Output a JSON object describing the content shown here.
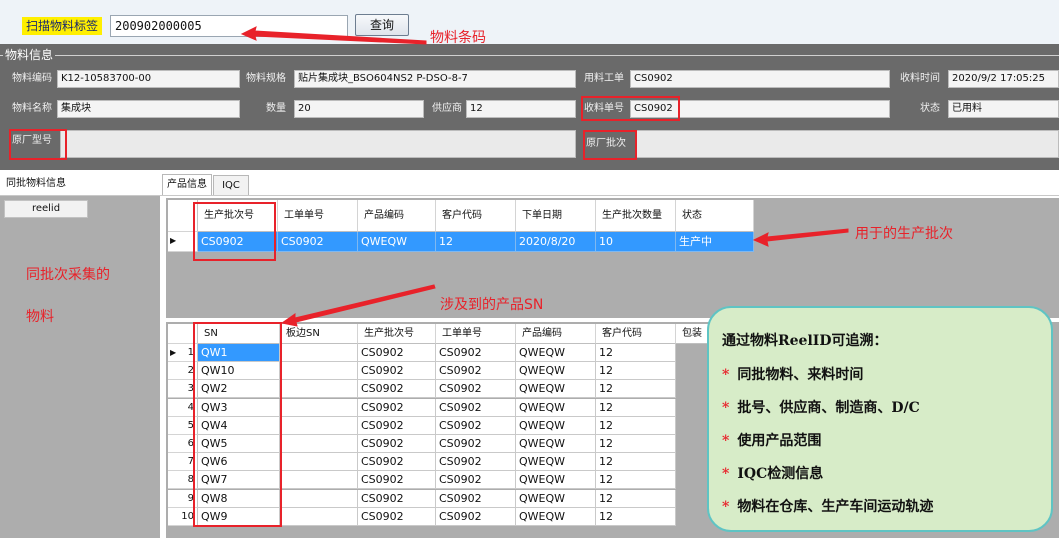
{
  "scan": {
    "label": "扫描物料标签",
    "value": "200902000005",
    "query_button": "查询",
    "note": "物料条码"
  },
  "info": {
    "title": "物料信息",
    "labels": {
      "material_code": "物料编码",
      "material_spec": "物料规格",
      "work_order": "用料工单",
      "receive_time": "收料时间",
      "material_name": "物料名称",
      "quantity": "数量",
      "supplier": "供应商",
      "receive_no": "收料单号",
      "status": "状态",
      "factory_model": "原厂型号",
      "factory_batch": "原厂批次"
    },
    "values": {
      "material_code": "K12-10583700-00",
      "material_spec": "贴片集成块_BSO604NS2 P-DSO-8-7",
      "work_order": "CS0902",
      "receive_time": "2020/9/2 17:05:25",
      "material_name": "集成块",
      "quantity": "20",
      "supplier": "12",
      "receive_no": "CS0902",
      "status": "已用料",
      "factory_model": "",
      "factory_batch": ""
    }
  },
  "left_panel": {
    "tab": "同批物料信息",
    "column": "reelid",
    "note_line1": "同批次采集的",
    "note_line2": "物料"
  },
  "tabs": [
    {
      "label": "产品信息",
      "active": true
    },
    {
      "label": "IQC",
      "active": false
    }
  ],
  "batch_grid": {
    "headers": [
      "生产批次号",
      "工单单号",
      "产品编码",
      "客户代码",
      "下单日期",
      "生产批次数量",
      "状态"
    ],
    "rows": [
      [
        "CS0902",
        "CS0902",
        "QWEQW",
        "12",
        "2020/8/20",
        "10",
        "生产中"
      ]
    ],
    "note": "用于的生产批次"
  },
  "sn_grid": {
    "headers": [
      "SN",
      "板边SN",
      "生产批次号",
      "工单单号",
      "产品编码",
      "客户代码",
      "包装"
    ],
    "rows": [
      [
        "1",
        "QW1",
        "",
        "CS0902",
        "CS0902",
        "QWEQW",
        "12"
      ],
      [
        "2",
        "QW10",
        "",
        "CS0902",
        "CS0902",
        "QWEQW",
        "12"
      ],
      [
        "3",
        "QW2",
        "",
        "CS0902",
        "CS0902",
        "QWEQW",
        "12"
      ],
      [
        "4",
        "QW3",
        "",
        "CS0902",
        "CS0902",
        "QWEQW",
        "12"
      ],
      [
        "5",
        "QW4",
        "",
        "CS0902",
        "CS0902",
        "QWEQW",
        "12"
      ],
      [
        "6",
        "QW5",
        "",
        "CS0902",
        "CS0902",
        "QWEQW",
        "12"
      ],
      [
        "7",
        "QW6",
        "",
        "CS0902",
        "CS0902",
        "QWEQW",
        "12"
      ],
      [
        "8",
        "QW7",
        "",
        "CS0902",
        "CS0902",
        "QWEQW",
        "12"
      ],
      [
        "9",
        "QW8",
        "",
        "CS0902",
        "CS0902",
        "QWEQW",
        "12"
      ],
      [
        "10",
        "QW9",
        "",
        "CS0902",
        "CS0902",
        "QWEQW",
        "12"
      ]
    ],
    "note": "涉及到的产品SN"
  },
  "callout": {
    "title": "通过物料ReelID可追溯：",
    "items": [
      "同批物料、来料时间",
      "批号、供应商、制造商、D/C",
      "使用产品范围",
      "IQC检测信息",
      "物料在仓库、生产车间运动轨迹"
    ]
  },
  "colors": {
    "annotation": "#e8222a",
    "selection": "#3399ff",
    "callout_bg": "#d7ecc8",
    "callout_border": "#5fc4c4",
    "scan_label_bg": "#ffef00"
  }
}
